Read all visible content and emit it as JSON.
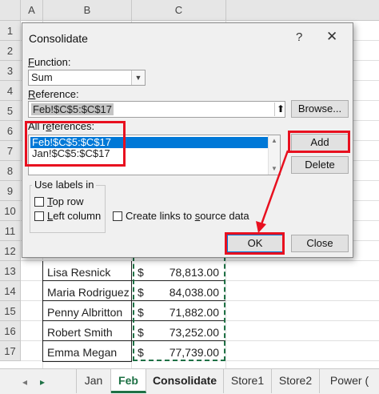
{
  "sheet": {
    "columns": [
      "A",
      "B",
      "C"
    ],
    "rows": [
      "1",
      "2",
      "3",
      "4",
      "5",
      "6",
      "7",
      "8",
      "9",
      "10",
      "11",
      "12",
      "13",
      "14",
      "15",
      "16",
      "17"
    ],
    "data_rows": [
      {
        "row": "13",
        "name": "Lisa Resnick",
        "currency": "$",
        "amount": "78,813.00"
      },
      {
        "row": "14",
        "name": "Maria Rodriguez",
        "currency": "$",
        "amount": "84,038.00"
      },
      {
        "row": "15",
        "name": "Penny Albritton",
        "currency": "$",
        "amount": "71,882.00"
      },
      {
        "row": "16",
        "name": "Robert Smith",
        "currency": "$",
        "amount": "73,252.00"
      },
      {
        "row": "17",
        "name": "Emma Megan",
        "currency": "$",
        "amount": "77,739.00"
      }
    ]
  },
  "tabs": {
    "nav_next": "▸",
    "sheets": [
      "Jan",
      "Feb",
      "Consolidate",
      "Store1",
      "Store2",
      "Power ("
    ],
    "active": "Feb"
  },
  "dialog": {
    "title": "Consolidate",
    "help": "?",
    "close": "✕",
    "function_label_u": "F",
    "function_label_rest": "unction:",
    "function_value": "Sum",
    "reference_label_u": "R",
    "reference_label_rest": "eference:",
    "reference_value": "Feb!$C$5:$C$17",
    "collapse_glyph": "⬆",
    "browse_label": "Browse...",
    "all_refs_label_pre": "All r",
    "all_refs_label_u": "e",
    "all_refs_label_rest": "ferences:",
    "references": [
      "Feb!$C$5:$C$17",
      "Jan!$C$5:$C$17"
    ],
    "add_label": "Add",
    "delete_label": "Delete",
    "labels_group_title": "Use labels in",
    "top_row_u": "T",
    "top_row_rest": "op row",
    "left_column_u": "L",
    "left_column_rest": "eft column",
    "create_links_pre": "Create links to ",
    "create_links_u": "s",
    "create_links_rest": "ource data",
    "ok_label": "OK",
    "close_label": "Close"
  },
  "colors": {
    "highlight": "#e8101f",
    "selection": "#0078d7",
    "excel_green": "#1e7145"
  }
}
